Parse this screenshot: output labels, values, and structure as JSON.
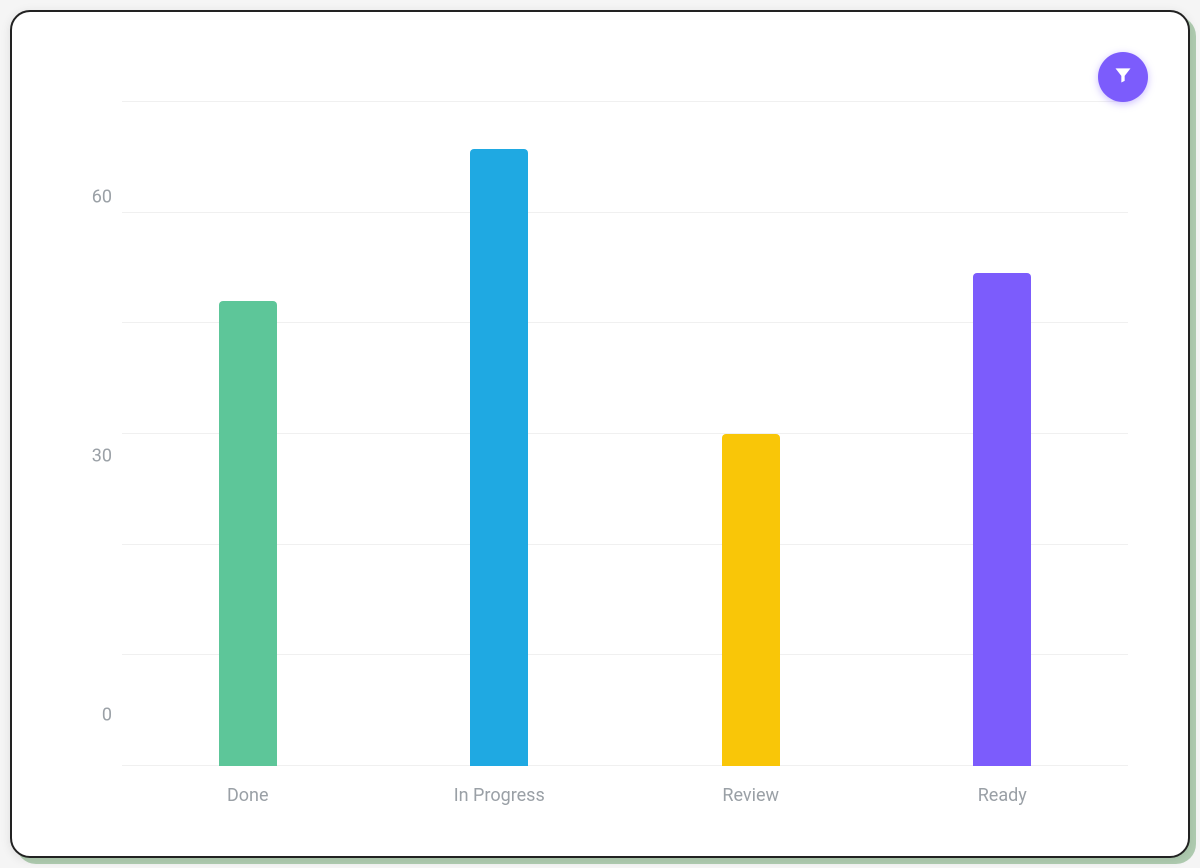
{
  "chart_data": {
    "type": "bar",
    "categories": [
      "Done",
      "In Progress",
      "Review",
      "Ready"
    ],
    "values": [
      49,
      65,
      35,
      52
    ],
    "colors": [
      "#5DC699",
      "#1FA9E2",
      "#F9C608",
      "#7C5CFC"
    ],
    "ylim": [
      0,
      70
    ],
    "y_ticks": [
      0,
      30,
      60
    ],
    "grid_count": 7,
    "title": "",
    "xlabel": "",
    "ylabel": ""
  },
  "filter_button": {
    "icon": "funnel-icon",
    "color": "#7C5CFC"
  }
}
